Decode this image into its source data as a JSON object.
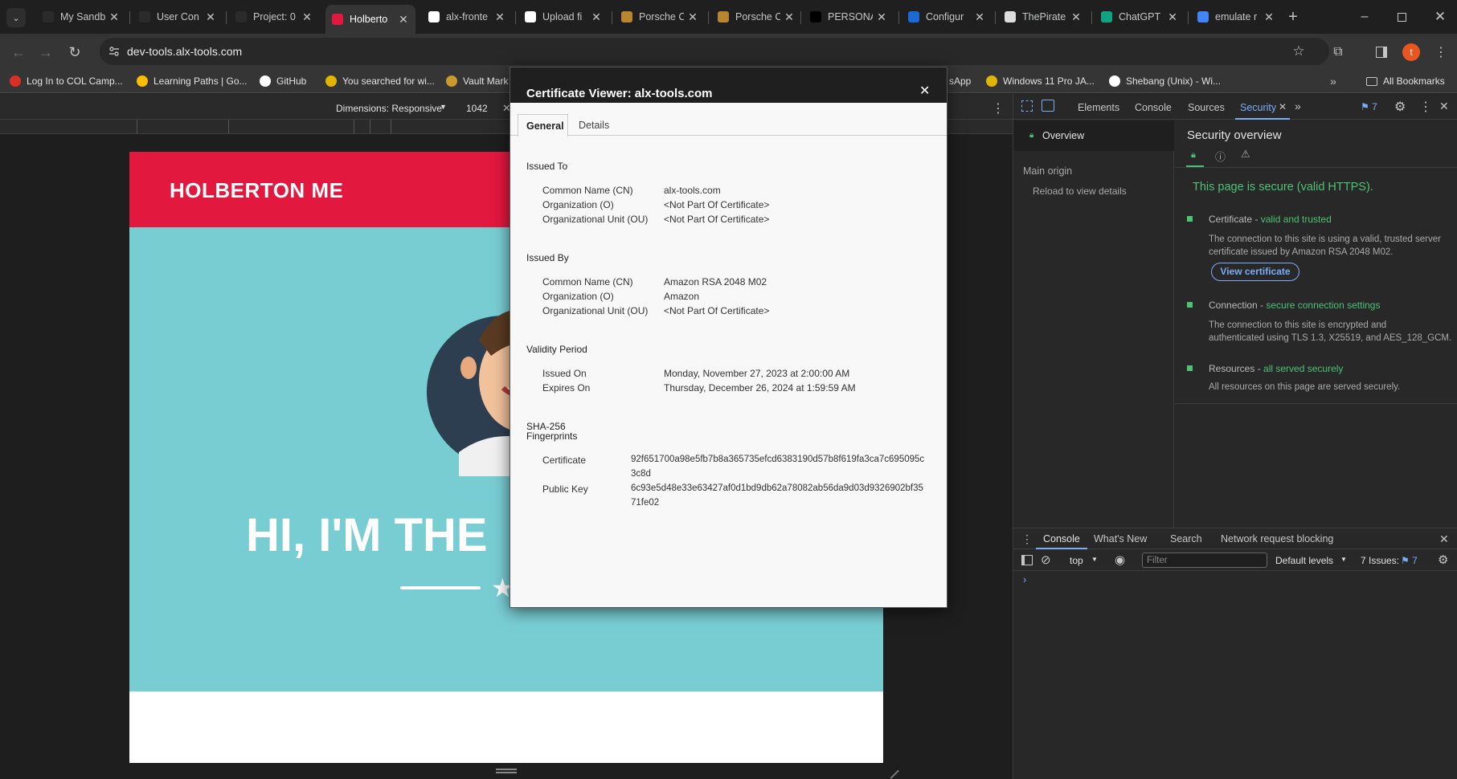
{
  "tabs": [
    {
      "title": "My Sandbo",
      "color": "#2b2b2b"
    },
    {
      "title": "User Con",
      "color": "#2b2b2b"
    },
    {
      "title": "Project: 0",
      "color": "#2b2b2b"
    },
    {
      "title": "Holberto",
      "color": "#e3183f"
    },
    {
      "title": "alx-fronte",
      "color": "#ffffff"
    },
    {
      "title": "Upload fi",
      "color": "#ffffff"
    },
    {
      "title": "Porsche C",
      "color": "#b8862e"
    },
    {
      "title": "Porsche C",
      "color": "#b8862e"
    },
    {
      "title": "PERSONA",
      "color": "#000000"
    },
    {
      "title": "Configur",
      "color": "#1c69d4"
    },
    {
      "title": "ThePirate",
      "color": "#dddddd"
    },
    {
      "title": "ChatGPT",
      "color": "#10a37f"
    },
    {
      "title": "emulate r",
      "color": "#4285f4"
    }
  ],
  "address": {
    "url": "dev-tools.alx-tools.com",
    "profile_initial": "t"
  },
  "bookmarks": [
    {
      "label": "Log In to COL Camp...",
      "color": "#d93025"
    },
    {
      "label": "Learning Paths | Go...",
      "color": "#fbbc04"
    },
    {
      "label": "GitHub",
      "color": "#ffffff"
    },
    {
      "label": "You searched for wi...",
      "color": "#e0b400"
    },
    {
      "label": "Vault Mark",
      "color": "#c99a2e"
    },
    {
      "label": "sApp",
      "color": "#25d366"
    },
    {
      "label": "Windows 11 Pro JA...",
      "color": "#e0b400"
    },
    {
      "label": "Shebang (Unix) - Wi...",
      "color": "#ffffff"
    }
  ],
  "all_bookmarks": "All Bookmarks",
  "device_toolbar": {
    "dimensions": "Dimensions: Responsive",
    "width": "1042"
  },
  "page": {
    "header_title": "HOLBERTON ME",
    "hero_text": "HI, I'M THE",
    "header_color": "#e3183f",
    "hero_color": "#78cdd3"
  },
  "certificate": {
    "title": "Certificate Viewer: alx-tools.com",
    "tabs": [
      "General",
      "Details"
    ],
    "issued_to": {
      "heading": "Issued To",
      "rows": [
        {
          "label": "Common Name (CN)",
          "value": "alx-tools.com"
        },
        {
          "label": "Organization (O)",
          "value": "<Not Part Of Certificate>"
        },
        {
          "label": "Organizational Unit (OU)",
          "value": "<Not Part Of Certificate>"
        }
      ]
    },
    "issued_by": {
      "heading": "Issued By",
      "rows": [
        {
          "label": "Common Name (CN)",
          "value": "Amazon RSA 2048 M02"
        },
        {
          "label": "Organization (O)",
          "value": "Amazon"
        },
        {
          "label": "Organizational Unit (OU)",
          "value": "<Not Part Of Certificate>"
        }
      ]
    },
    "validity": {
      "heading": "Validity Period",
      "rows": [
        {
          "label": "Issued On",
          "value": "Monday, November 27, 2023 at 2:00:00 AM"
        },
        {
          "label": "Expires On",
          "value": "Thursday, December 26, 2024 at 1:59:59 AM"
        }
      ]
    },
    "fingerprints": {
      "heading_line1": "SHA-256",
      "heading_line2": "Fingerprints",
      "rows": [
        {
          "label": "Certificate",
          "value_line1": "92f651700a98e5fb7b8a365735efcd6383190d57b8f619fa3ca7c695095c",
          "value_line2": "3c8d"
        },
        {
          "label": "Public Key",
          "value_line1": "6c93e5d48e33e63427af0d1bd9db62a78082ab56da9d03d9326902bf35",
          "value_line2": "71fe02"
        }
      ]
    }
  },
  "devtools": {
    "tabs": [
      "Elements",
      "Console",
      "Sources",
      "Security"
    ],
    "issues_badge": "7",
    "sidebar": {
      "overview": "Overview",
      "main_origin": "Main origin",
      "reload": "Reload to view details"
    },
    "overview_title": "Security overview",
    "secure_msg": "This page is secure (valid HTTPS).",
    "certificate": {
      "label": "Certificate - ",
      "status": "valid and trusted",
      "desc_line1": "The connection to this site is using a valid, trusted server",
      "desc_line2": "certificate issued by Amazon RSA 2048 M02.",
      "button": "View certificate"
    },
    "connection": {
      "label": "Connection - ",
      "status": "secure connection settings",
      "desc_line1": "The connection to this site is encrypted and",
      "desc_line2": "authenticated using TLS 1.3, X25519, and AES_128_GCM."
    },
    "resources": {
      "label": "Resources - ",
      "status": "all served securely",
      "desc": "All resources on this page are served securely."
    },
    "drawer_tabs": [
      "Console",
      "What's New",
      "Search",
      "Network request blocking"
    ],
    "console_context": "top",
    "filter_placeholder": "Filter",
    "levels": "Default levels",
    "issues_label": "7 Issues:",
    "issues_count": "7"
  },
  "colors": {
    "accent_blue": "#7cacf8",
    "secure_green": "#4cc274"
  }
}
